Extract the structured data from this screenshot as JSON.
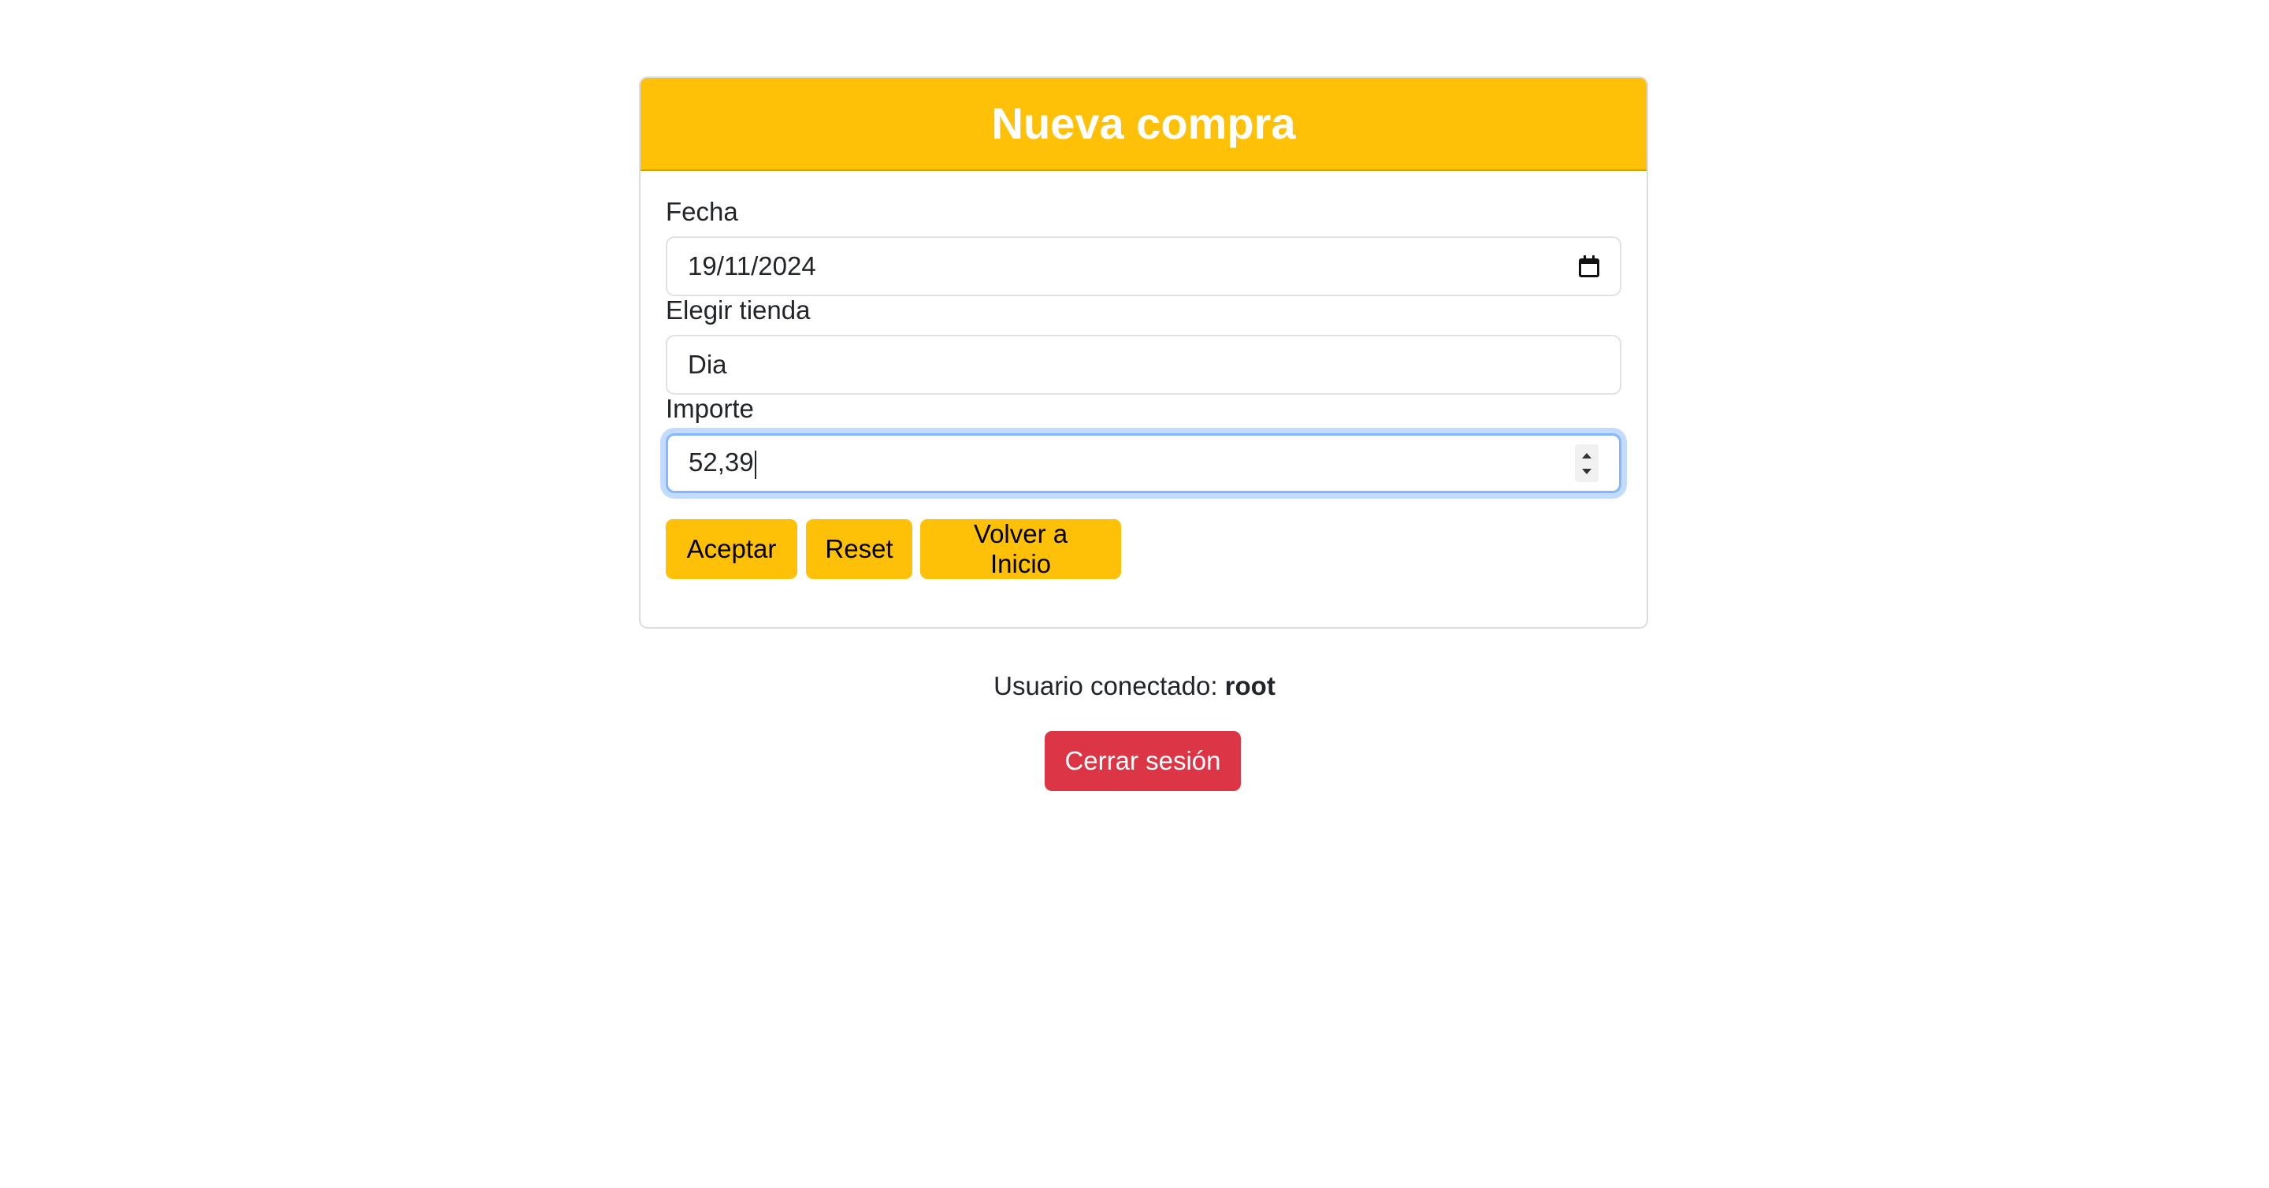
{
  "card": {
    "title": "Nueva compra"
  },
  "form": {
    "fecha": {
      "label": "Fecha",
      "value": "19/11/2024"
    },
    "tienda": {
      "label": "Elegir tienda",
      "value": "Dia"
    },
    "importe": {
      "label": "Importe",
      "value": "52,39"
    }
  },
  "buttons": {
    "aceptar": "Aceptar",
    "reset": "Reset",
    "volver": "Volver a Inicio"
  },
  "session": {
    "user_prefix": "Usuario conectado:",
    "username": "root",
    "logout_label": "Cerrar sesión"
  },
  "colors": {
    "header": "#ffc107",
    "button": "#ffc107",
    "logout": "#dc3545",
    "focus_ring": "#86b7fe"
  },
  "icons": {
    "date_picker": "calendar-icon",
    "number_spinner": "spinner-icon"
  }
}
